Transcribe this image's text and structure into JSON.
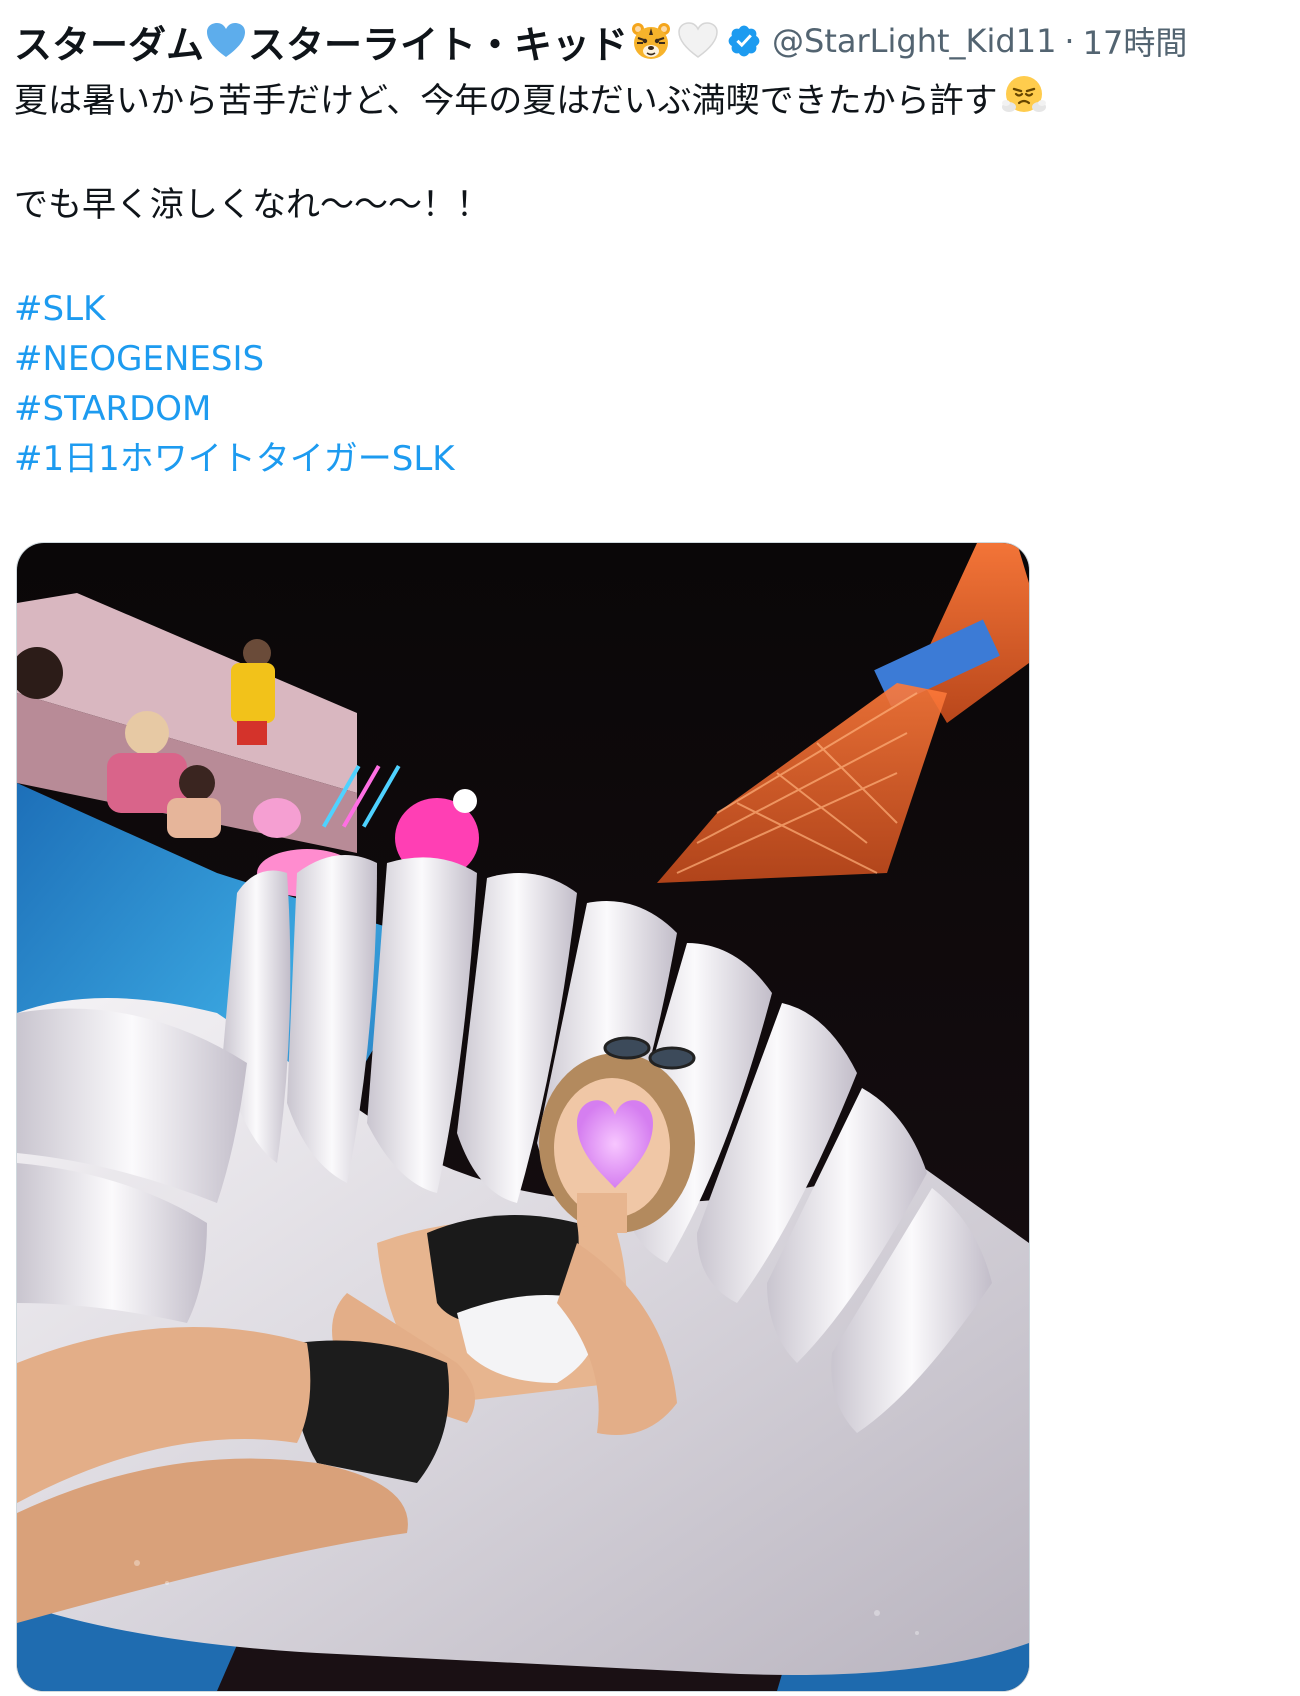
{
  "tweet": {
    "author": {
      "display_name_part1": "スターダム",
      "display_name_part2": "スターライト・キッド",
      "handle": "@StarLight_Kid11",
      "separator": "·",
      "time": "17時間"
    },
    "icons": {
      "after_part1": "blue-heart-icon",
      "after_part2_a": "tiger-face-icon",
      "after_part2_b": "white-heart-icon",
      "verified": "verified-badge-icon",
      "end_of_line1": "face-with-steam-icon"
    },
    "text": {
      "line1": "夏は暑いから苦手だけど、今年の夏はだいぶ満喫できたから許す",
      "line2": "でも早く涼しくなれ〜〜〜！！"
    },
    "hashtags": [
      "#SLK",
      "#NEOGENESIS",
      "#STARDOM",
      "#1日1ホワイトタイガーSLK"
    ],
    "colors": {
      "hashtag": "#1d9bf0",
      "verified": "#1d9bf0",
      "text": "#0f1419",
      "secondary": "#536471"
    }
  }
}
